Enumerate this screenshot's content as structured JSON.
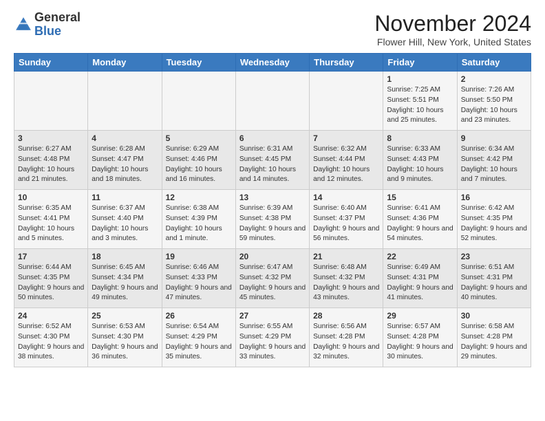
{
  "logo": {
    "text_general": "General",
    "text_blue": "Blue"
  },
  "header": {
    "month_title": "November 2024",
    "location": "Flower Hill, New York, United States"
  },
  "days_of_week": [
    "Sunday",
    "Monday",
    "Tuesday",
    "Wednesday",
    "Thursday",
    "Friday",
    "Saturday"
  ],
  "weeks": [
    [
      {
        "day": "",
        "info": ""
      },
      {
        "day": "",
        "info": ""
      },
      {
        "day": "",
        "info": ""
      },
      {
        "day": "",
        "info": ""
      },
      {
        "day": "",
        "info": ""
      },
      {
        "day": "1",
        "info": "Sunrise: 7:25 AM\nSunset: 5:51 PM\nDaylight: 10 hours and 25 minutes."
      },
      {
        "day": "2",
        "info": "Sunrise: 7:26 AM\nSunset: 5:50 PM\nDaylight: 10 hours and 23 minutes."
      }
    ],
    [
      {
        "day": "3",
        "info": "Sunrise: 6:27 AM\nSunset: 4:48 PM\nDaylight: 10 hours and 21 minutes."
      },
      {
        "day": "4",
        "info": "Sunrise: 6:28 AM\nSunset: 4:47 PM\nDaylight: 10 hours and 18 minutes."
      },
      {
        "day": "5",
        "info": "Sunrise: 6:29 AM\nSunset: 4:46 PM\nDaylight: 10 hours and 16 minutes."
      },
      {
        "day": "6",
        "info": "Sunrise: 6:31 AM\nSunset: 4:45 PM\nDaylight: 10 hours and 14 minutes."
      },
      {
        "day": "7",
        "info": "Sunrise: 6:32 AM\nSunset: 4:44 PM\nDaylight: 10 hours and 12 minutes."
      },
      {
        "day": "8",
        "info": "Sunrise: 6:33 AM\nSunset: 4:43 PM\nDaylight: 10 hours and 9 minutes."
      },
      {
        "day": "9",
        "info": "Sunrise: 6:34 AM\nSunset: 4:42 PM\nDaylight: 10 hours and 7 minutes."
      }
    ],
    [
      {
        "day": "10",
        "info": "Sunrise: 6:35 AM\nSunset: 4:41 PM\nDaylight: 10 hours and 5 minutes."
      },
      {
        "day": "11",
        "info": "Sunrise: 6:37 AM\nSunset: 4:40 PM\nDaylight: 10 hours and 3 minutes."
      },
      {
        "day": "12",
        "info": "Sunrise: 6:38 AM\nSunset: 4:39 PM\nDaylight: 10 hours and 1 minute."
      },
      {
        "day": "13",
        "info": "Sunrise: 6:39 AM\nSunset: 4:38 PM\nDaylight: 9 hours and 59 minutes."
      },
      {
        "day": "14",
        "info": "Sunrise: 6:40 AM\nSunset: 4:37 PM\nDaylight: 9 hours and 56 minutes."
      },
      {
        "day": "15",
        "info": "Sunrise: 6:41 AM\nSunset: 4:36 PM\nDaylight: 9 hours and 54 minutes."
      },
      {
        "day": "16",
        "info": "Sunrise: 6:42 AM\nSunset: 4:35 PM\nDaylight: 9 hours and 52 minutes."
      }
    ],
    [
      {
        "day": "17",
        "info": "Sunrise: 6:44 AM\nSunset: 4:35 PM\nDaylight: 9 hours and 50 minutes."
      },
      {
        "day": "18",
        "info": "Sunrise: 6:45 AM\nSunset: 4:34 PM\nDaylight: 9 hours and 49 minutes."
      },
      {
        "day": "19",
        "info": "Sunrise: 6:46 AM\nSunset: 4:33 PM\nDaylight: 9 hours and 47 minutes."
      },
      {
        "day": "20",
        "info": "Sunrise: 6:47 AM\nSunset: 4:32 PM\nDaylight: 9 hours and 45 minutes."
      },
      {
        "day": "21",
        "info": "Sunrise: 6:48 AM\nSunset: 4:32 PM\nDaylight: 9 hours and 43 minutes."
      },
      {
        "day": "22",
        "info": "Sunrise: 6:49 AM\nSunset: 4:31 PM\nDaylight: 9 hours and 41 minutes."
      },
      {
        "day": "23",
        "info": "Sunrise: 6:51 AM\nSunset: 4:31 PM\nDaylight: 9 hours and 40 minutes."
      }
    ],
    [
      {
        "day": "24",
        "info": "Sunrise: 6:52 AM\nSunset: 4:30 PM\nDaylight: 9 hours and 38 minutes."
      },
      {
        "day": "25",
        "info": "Sunrise: 6:53 AM\nSunset: 4:30 PM\nDaylight: 9 hours and 36 minutes."
      },
      {
        "day": "26",
        "info": "Sunrise: 6:54 AM\nSunset: 4:29 PM\nDaylight: 9 hours and 35 minutes."
      },
      {
        "day": "27",
        "info": "Sunrise: 6:55 AM\nSunset: 4:29 PM\nDaylight: 9 hours and 33 minutes."
      },
      {
        "day": "28",
        "info": "Sunrise: 6:56 AM\nSunset: 4:28 PM\nDaylight: 9 hours and 32 minutes."
      },
      {
        "day": "29",
        "info": "Sunrise: 6:57 AM\nSunset: 4:28 PM\nDaylight: 9 hours and 30 minutes."
      },
      {
        "day": "30",
        "info": "Sunrise: 6:58 AM\nSunset: 4:28 PM\nDaylight: 9 hours and 29 minutes."
      }
    ]
  ]
}
